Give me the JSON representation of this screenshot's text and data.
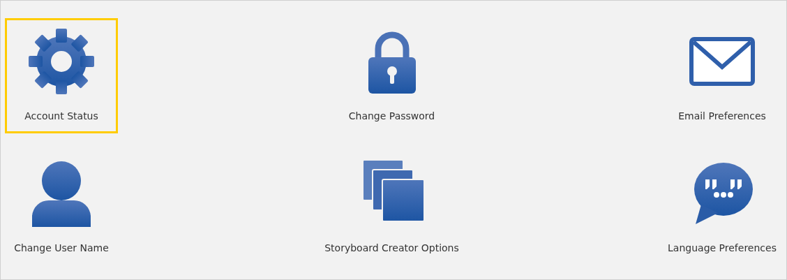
{
  "tiles": [
    {
      "kind": "gear",
      "label": "Account Status",
      "selected": true
    },
    {
      "kind": "lock",
      "label": "Change Password",
      "selected": false
    },
    {
      "kind": "mail",
      "label": "Email Preferences",
      "selected": false
    },
    {
      "kind": "user",
      "label": "Change User Name",
      "selected": false
    },
    {
      "kind": "pages",
      "label": "Storyboard Creator Options",
      "selected": false
    },
    {
      "kind": "chat",
      "label": "Language Preferences",
      "selected": false
    }
  ]
}
